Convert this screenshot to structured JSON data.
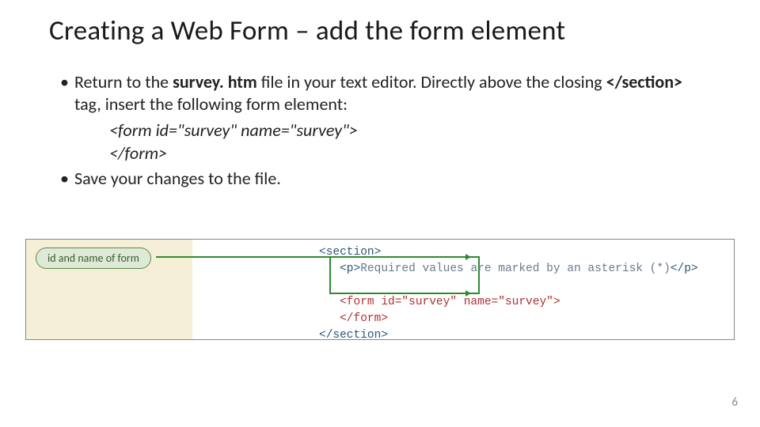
{
  "title": "Creating a Web Form – add the form element",
  "bullets": {
    "b1_pre": "Return to the ",
    "b1_bold1": "survey. htm",
    "b1_mid": " file in your text editor. Directly above the closing ",
    "b1_bold2": "</section>",
    "b1_post": " tag, insert the following form element:",
    "code_line1": "<form id=\"survey\" name=\"survey\">",
    "code_line2": "</form>",
    "b2": "Save your changes to the file."
  },
  "figure": {
    "callout": "id and name of form",
    "lines": {
      "l1_a": "<section>",
      "l2_indent": "   ",
      "l2_a": "<p>",
      "l2_txt": "Required values are marked by an asterisk (*)",
      "l2_b": "</p>",
      "blank": " ",
      "l3_indent": "   ",
      "l3": "<form id=\"survey\" name=\"survey\">",
      "l4_indent": "   ",
      "l4": "</form>",
      "l5": "</section>"
    }
  },
  "pagenum": "6"
}
